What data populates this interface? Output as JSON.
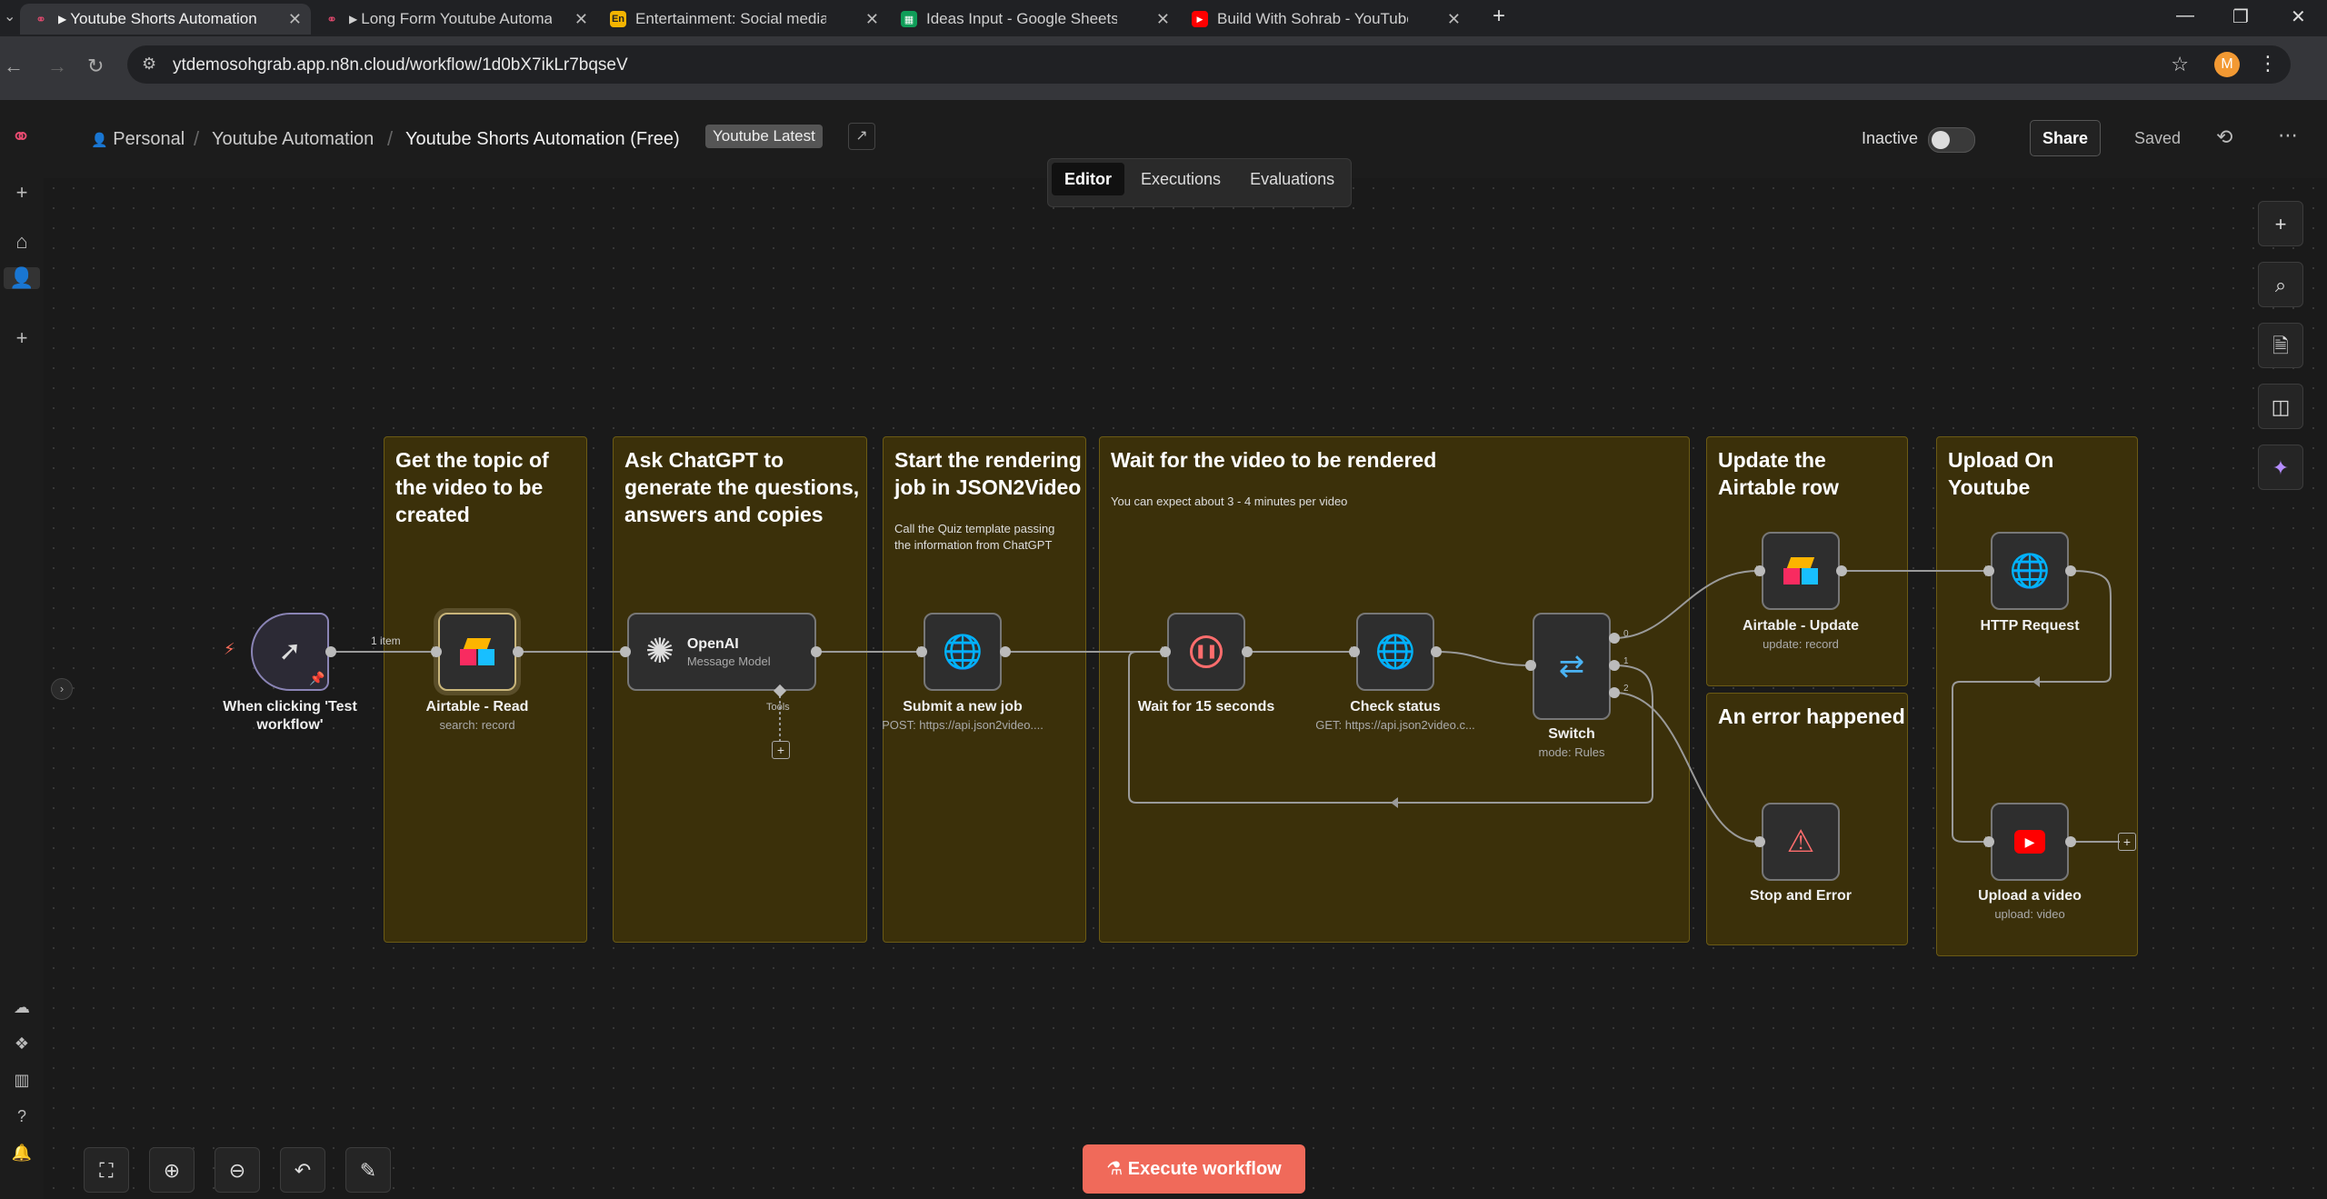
{
  "browser": {
    "tabs": [
      {
        "title": "Youtube Shorts Automation (",
        "favicon": "n8n-icon",
        "color": "#ea4b71"
      },
      {
        "title": "Long Form Youtube Automat",
        "favicon": "n8n-icon",
        "color": "#ea4b71"
      },
      {
        "title": "Entertainment: Social media re",
        "favicon": "En",
        "color": "#f4b400"
      },
      {
        "title": "Ideas Input - Google Sheets",
        "favicon": "sheets-icon",
        "color": "#0f9d58"
      },
      {
        "title": "Build With Sohrab - YouTube",
        "favicon": "youtube-icon",
        "color": "#ff0000"
      }
    ],
    "url": "ytdemosohgrab.app.n8n.cloud/workflow/1d0bX7ikLr7bqseV",
    "profile_initial": "M"
  },
  "header": {
    "breadcrumb": [
      "Personal",
      "Youtube Automation",
      "Youtube Shorts Automation (Free)"
    ],
    "tag": "Youtube Latest",
    "status_label": "Inactive",
    "share_label": "Share",
    "saved_label": "Saved"
  },
  "mode_tabs": [
    "Editor",
    "Executions",
    "Evaluations"
  ],
  "stickies": [
    {
      "title": [
        "Get the topic of",
        "the video to be",
        "created"
      ],
      "subtitle": []
    },
    {
      "title": [
        "Ask ChatGPT to",
        "generate the questions,",
        "answers and copies"
      ],
      "subtitle": []
    },
    {
      "title": [
        "Start the rendering",
        "job in JSON2Video"
      ],
      "subtitle": [
        "Call the Quiz template passing",
        "the information from ChatGPT"
      ]
    },
    {
      "title": [
        "Wait for the video to be rendered"
      ],
      "subtitle": [
        "You can expect about 3 - 4 minutes per video"
      ]
    },
    {
      "title": [
        "Update the",
        "Airtable row"
      ],
      "subtitle": []
    },
    {
      "title": [
        "An error happened"
      ],
      "subtitle": []
    },
    {
      "title": [
        "Upload On",
        "Youtube"
      ],
      "subtitle": []
    }
  ],
  "nodes": {
    "trigger": {
      "label": [
        "When clicking 'Test",
        "workflow'"
      ]
    },
    "airtable_read": {
      "label": "Airtable - Read",
      "sub": "search: record"
    },
    "openai": {
      "label": "OpenAI",
      "sub": "Message Model",
      "tools": "Tools"
    },
    "submit_job": {
      "label": "Submit a new job",
      "sub": "POST: https://api.json2video...."
    },
    "wait": {
      "label": "Wait for 15 seconds"
    },
    "check_status": {
      "label": "Check status",
      "sub": "GET: https://api.json2video.c..."
    },
    "switch": {
      "label": "Switch",
      "sub": "mode: Rules",
      "outputs": [
        "0",
        "1",
        "2"
      ]
    },
    "airtable_update": {
      "label": "Airtable - Update",
      "sub": "update: record"
    },
    "stop_error": {
      "label": "Stop and Error"
    },
    "http_request": {
      "label": "HTTP Request"
    },
    "upload_video": {
      "label": "Upload a video",
      "sub": "upload: video"
    }
  },
  "edge_labels": {
    "trigger_to_airtable": "1 item"
  },
  "execute_label": "Execute workflow"
}
